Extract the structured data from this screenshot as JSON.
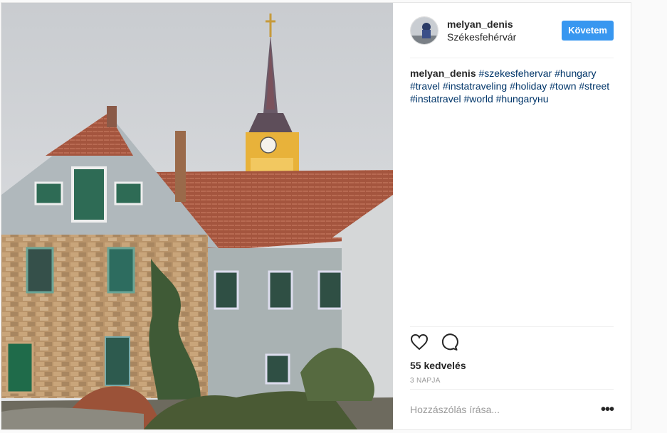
{
  "post": {
    "image_alt": "Old stone house with red tiled roof and church spire",
    "header": {
      "username": "melyan_denis",
      "location": "Székesfehérvár",
      "follow_label": "Követem"
    },
    "caption": {
      "username": "melyan_denis",
      "hashtags": [
        "#szekesfehervar",
        "#hungary",
        "#travel",
        "#instatraveling",
        "#holiday",
        "#town",
        "#street",
        "#instatravel",
        "#world",
        "#hungaryнu"
      ]
    },
    "actions": {
      "like_icon": "heart-icon",
      "comment_icon": "comment-icon"
    },
    "likes_text": "55 kedvelés",
    "timestamp": "3 napja",
    "comment_placeholder": "Hozzászólás írása...",
    "more_label": "•••"
  }
}
